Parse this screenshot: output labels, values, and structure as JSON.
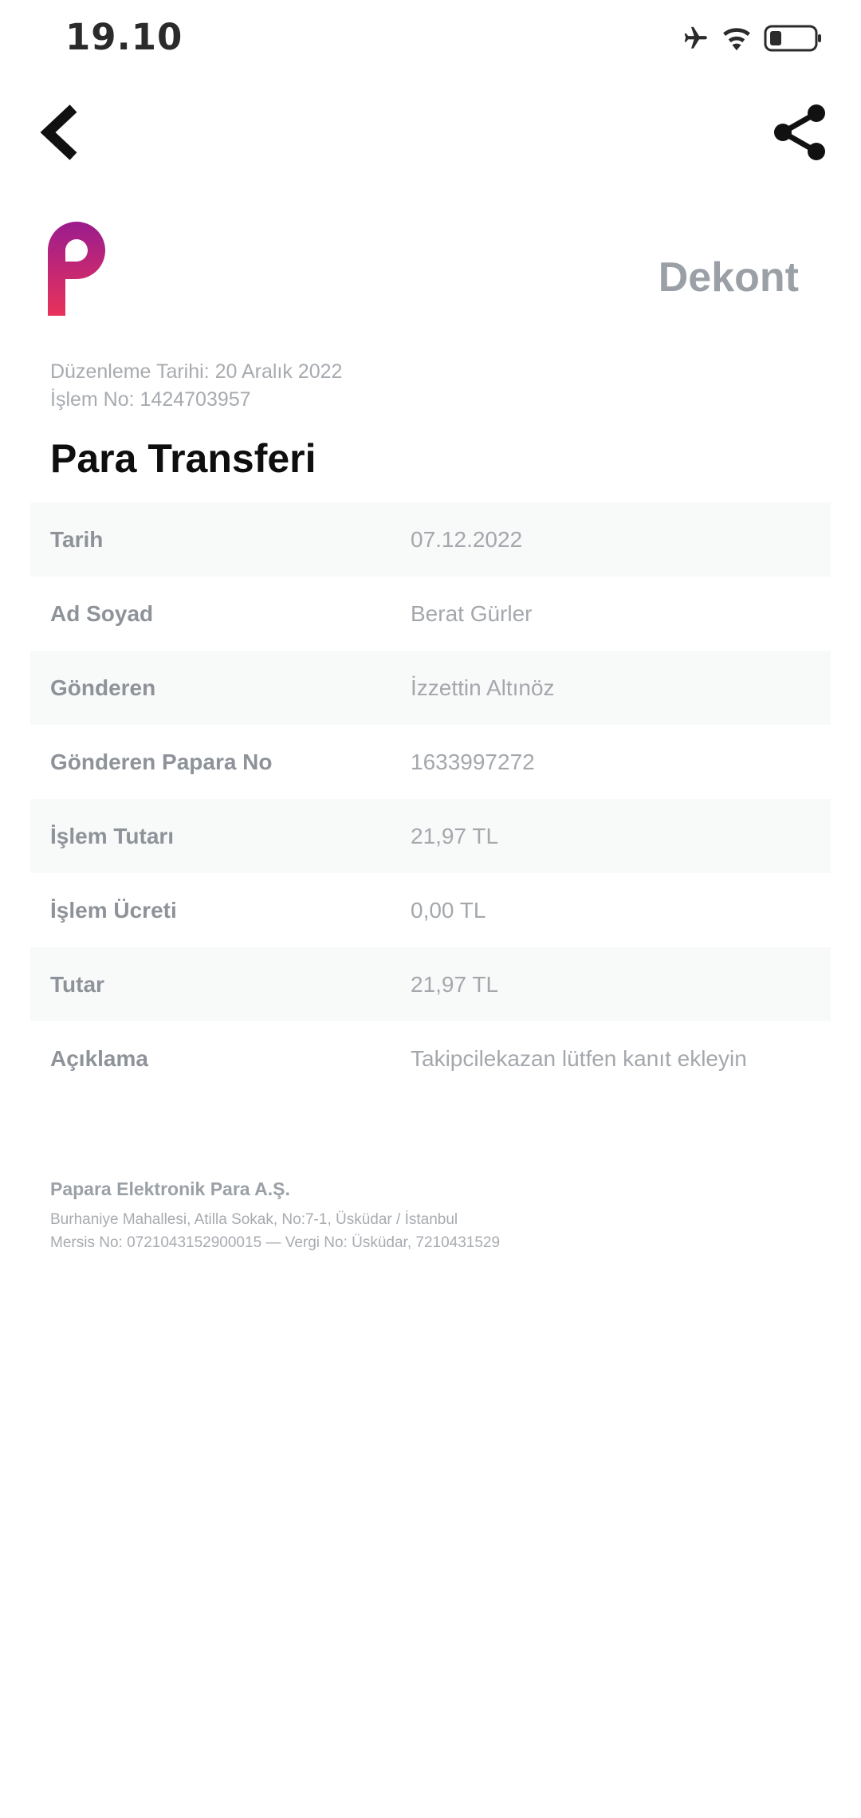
{
  "status_bar": {
    "time": "19.10",
    "icons": [
      "airplane-icon",
      "wifi-icon",
      "battery-icon"
    ]
  },
  "nav": {
    "back_icon": "chevron-left-icon",
    "share_icon": "share-icon"
  },
  "header": {
    "logo": "papara-logo",
    "doc_type": "Dekont",
    "issue_date": "Düzenleme Tarihi: 20 Aralık 2022",
    "transaction_no": "İşlem No: 1424703957"
  },
  "title": "Para Transferi",
  "details": [
    {
      "label": "Tarih",
      "value": "07.12.2022"
    },
    {
      "label": "Ad Soyad",
      "value": "Berat Gürler"
    },
    {
      "label": "Gönderen",
      "value": "İzzettin Altınöz"
    },
    {
      "label": "Gönderen Papara No",
      "value": "1633997272"
    },
    {
      "label": "İşlem Tutarı",
      "value": "21,97 TL"
    },
    {
      "label": "İşlem Ücreti",
      "value": "0,00 TL"
    },
    {
      "label": "Tutar",
      "value": "21,97 TL"
    },
    {
      "label": "Açıklama",
      "value": "Takipcilekazan lütfen kanıt ekleyin"
    }
  ],
  "footer": {
    "company": "Papara Elektronik Para A.Ş.",
    "address": "Burhaniye Mahallesi, Atilla Sokak, No:7-1, Üsküdar / İstanbul",
    "registry": "Mersis No: 0721043152900015 — Vergi No: Üsküdar, 7210431529"
  },
  "colors": {
    "logo_gradient_top": "#9b1c8e",
    "logo_gradient_bottom": "#e8325a",
    "row_shade": "#f8f9f9",
    "label_text": "#8e9399",
    "value_text": "#a4a8ad"
  }
}
